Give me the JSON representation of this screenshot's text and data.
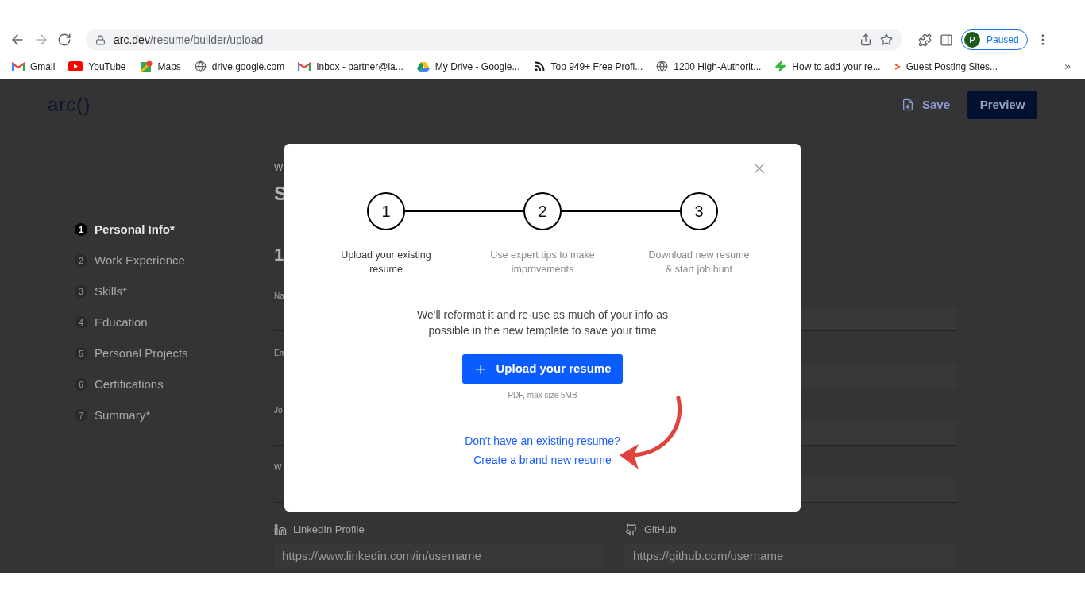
{
  "browser": {
    "url_host": "arc.dev",
    "url_path": "/resume/builder/upload",
    "profile_initial": "P",
    "profile_status": "Paused",
    "bookmarks": [
      {
        "kind": "gmail",
        "label": "Gmail"
      },
      {
        "kind": "youtube",
        "label": "YouTube"
      },
      {
        "kind": "maps",
        "label": "Maps"
      },
      {
        "kind": "globe",
        "label": "drive.google.com"
      },
      {
        "kind": "gmail",
        "label": "Inbox - partner@la..."
      },
      {
        "kind": "drive",
        "label": "My Drive - Google..."
      },
      {
        "kind": "feed",
        "label": "Top 949+ Free Profi..."
      },
      {
        "kind": "globe",
        "label": "1200 High-Authorit..."
      },
      {
        "kind": "bolt",
        "label": "How to add your re..."
      },
      {
        "kind": "chevron",
        "label": "Guest Posting Sites..."
      }
    ],
    "overflow": "»"
  },
  "header": {
    "logo": "arc()",
    "save": "Save",
    "preview": "Preview"
  },
  "sidebar": {
    "items": [
      {
        "number": "1",
        "label": "Personal Info*",
        "selected": true
      },
      {
        "number": "2",
        "label": "Work Experience",
        "selected": false
      },
      {
        "number": "3",
        "label": "Skills*",
        "selected": false
      },
      {
        "number": "4",
        "label": "Education",
        "selected": false
      },
      {
        "number": "5",
        "label": "Personal Projects",
        "selected": false
      },
      {
        "number": "6",
        "label": "Certifications",
        "selected": false
      },
      {
        "number": "7",
        "label": "Summary*",
        "selected": false
      }
    ]
  },
  "form": {
    "eyebrow": "W",
    "title": "S",
    "section": "1",
    "field_labels": [
      "Na",
      "Em",
      "Jo",
      "W"
    ],
    "linkedin": {
      "label": "LinkedIn Profile",
      "placeholder": "https://www.linkedin.com/in/username"
    },
    "github": {
      "label": "GitHub",
      "placeholder": "https://github.com/username"
    }
  },
  "modal": {
    "steps": [
      {
        "number": "1",
        "label": "Upload your existing resume",
        "current": true
      },
      {
        "number": "2",
        "label": "Use expert tips to make improvements",
        "current": false
      },
      {
        "number": "3",
        "label": "Download new resume & start job hunt",
        "current": false
      }
    ],
    "description": "We'll reformat it and re-use as much of your info as possible in the new template to save your time",
    "upload_button": "Upload your resume",
    "note": "PDF, max size 5MB",
    "link_question": "Don't have an existing resume?",
    "link_create": "Create a brand new resume"
  }
}
